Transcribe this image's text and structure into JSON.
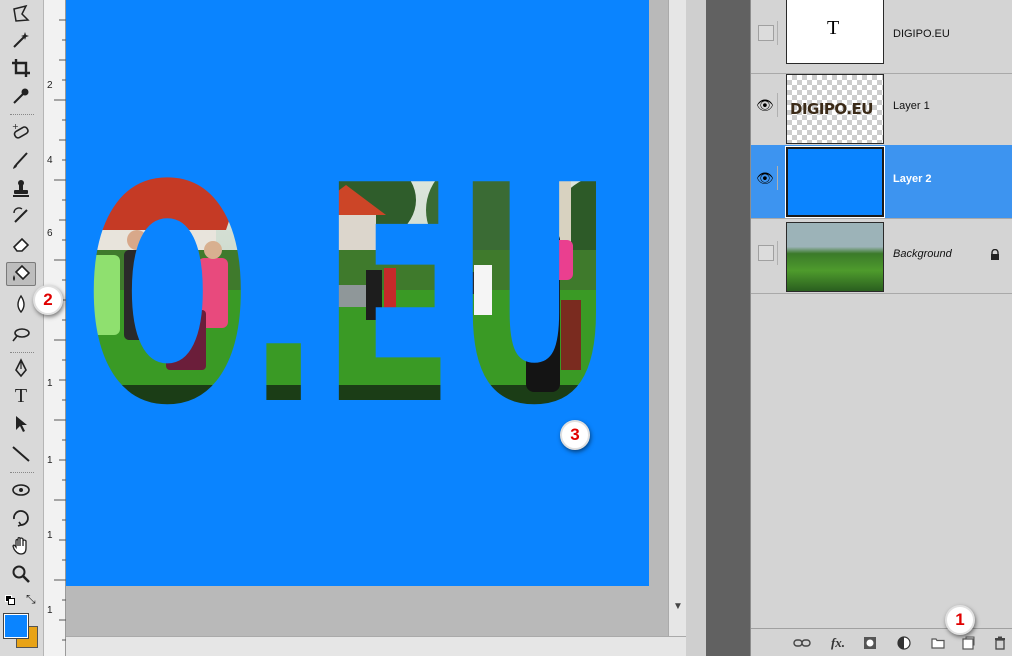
{
  "toolbar": {
    "tools": [
      "polygonal-lasso-icon",
      "magic-wand-icon",
      "crop-icon",
      "eyedropper-icon",
      "spot-healing-icon",
      "brush-icon",
      "clone-stamp-icon",
      "history-brush-icon",
      "eraser-icon",
      "paint-bucket-icon",
      "blur-icon",
      "dodge-icon",
      "pen-icon",
      "type-icon",
      "path-selection-icon",
      "line-icon",
      "3d-rotate-icon",
      "3d-orbit-icon",
      "hand-icon",
      "zoom-icon"
    ],
    "active_tool": "paint-bucket-icon",
    "type_tool_glyph": "T",
    "foreground_color": "#0a84ff",
    "background_color": "#e8a317"
  },
  "ruler": {
    "labels": [
      "2",
      "4",
      "6",
      "8",
      "1",
      "1",
      "1",
      "1"
    ]
  },
  "canvas": {
    "fill_color": "#0a84ff",
    "text": "O.EU"
  },
  "layers": [
    {
      "name": "DIGIPO.EU",
      "visible": false,
      "selected": false,
      "thumb": "T",
      "italic": false,
      "locked": false
    },
    {
      "name": "Layer 1",
      "visible": true,
      "selected": false,
      "thumb_text": "DIGIPO.EU",
      "italic": false,
      "locked": false
    },
    {
      "name": "Layer 2",
      "visible": true,
      "selected": true,
      "italic": false,
      "locked": false
    },
    {
      "name": "Background",
      "visible": false,
      "selected": false,
      "italic": true,
      "locked": true
    }
  ],
  "footer": {
    "buttons": [
      "link-icon",
      "fx-icon",
      "mask-icon",
      "adjustment-icon",
      "folder-icon",
      "new-layer-icon",
      "trash-icon"
    ],
    "fx_label": "fx."
  },
  "annotations": {
    "one": "1",
    "two": "2",
    "three": "3"
  },
  "colors": {
    "accent_blue": "#0a84ff",
    "selection_blue": "#3d94f0",
    "badge_red": "#e00000"
  }
}
